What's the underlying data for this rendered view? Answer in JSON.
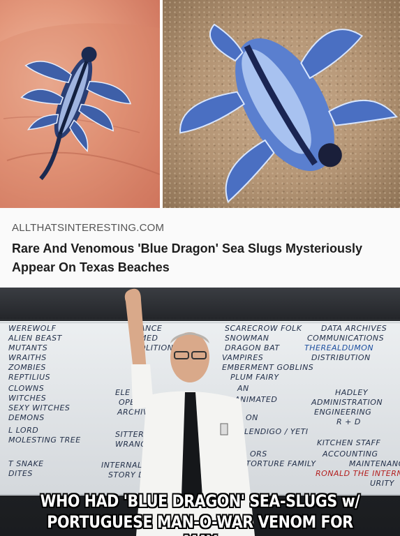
{
  "article": {
    "domain": "ALLTHATSINTERESTING.COM",
    "headline": "Rare And Venomous 'Blue Dragon' Sea Slugs Mysteriously Appear On Texas Beaches"
  },
  "meme": {
    "caption_line1": "WHO HAD 'BLUE DRAGON' SEA-SLUGS w/",
    "caption_line2": "PORTUGUESE MAN-O-WAR VENOM FOR MAY",
    "board": {
      "col1": [
        "WEREWOLF",
        "ALIEN BEAST",
        "MUTANTS",
        "WRAITHS",
        "ZOMBIES",
        "REPTILIUS",
        "CLOWNS",
        "WITCHES",
        "SEXY WITCHES",
        "DEMONS",
        "L LORD",
        "MOLESTING TREE",
        "T SNAKE",
        "DITES"
      ],
      "col2": [
        "ANCE",
        "MED",
        "OLITION",
        "ELE",
        "OPERA",
        "ARCHIV",
        "SITTERS",
        "WRANG",
        "INTERNAL LOG",
        "STORY DEP"
      ],
      "col3": [
        "SCARECROW FOLK",
        "SNOWMAN",
        "DRAGON BAT",
        "VAMPIRES",
        "EMBERMENT GOBLINS",
        "PLUM FAIRY",
        "AN",
        "ANIMATED",
        "ON",
        "LENDIGO / YETI",
        "ORS",
        "TORTURE FAMILY"
      ],
      "col4": [
        "DATA ARCHIVES",
        "COMMUNICATIONS",
        "THEREALDUMON",
        "DISTRIBUTION",
        "HADLEY",
        "ADMINISTRATION",
        "ENGINEERING",
        "R + D",
        "KITCHEN STAFF",
        "ACCOUNTING",
        "MAINTENANCE",
        "RONALD THE INTERN",
        "URITY"
      ]
    }
  }
}
